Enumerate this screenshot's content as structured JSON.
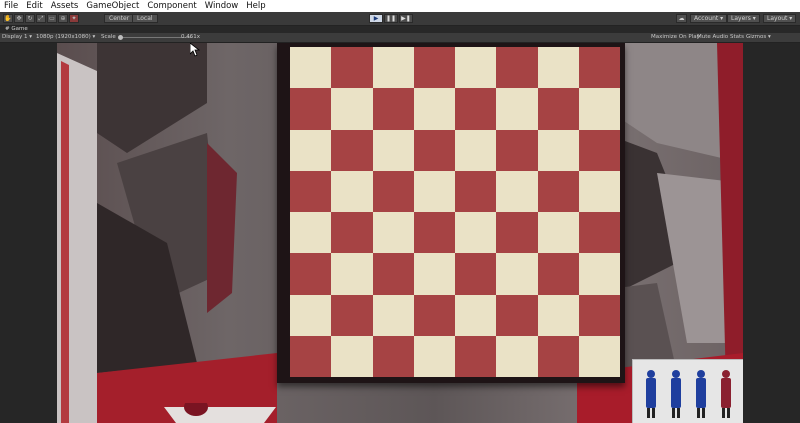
{
  "menubar": {
    "items": [
      "File",
      "Edit",
      "Assets",
      "GameObject",
      "Component",
      "Window",
      "Help"
    ]
  },
  "toolbar": {
    "tools": [
      "hand-icon",
      "move-icon",
      "rotate-icon",
      "scale-icon",
      "rect-icon",
      "transform-icon",
      "custom-tool-icon"
    ],
    "pivot_label": "Center",
    "space_label": "Local",
    "play": "▶",
    "pause": "❚❚",
    "step": "▶❚",
    "account_label": "Account ▾",
    "layers_label": "Layers ▾",
    "layout_label": "Layout ▾",
    "cloud_icon": "cloud-icon"
  },
  "game_tab": {
    "label": "# Game"
  },
  "gamebar": {
    "display": "Display 1 ▾",
    "resolution": "1080p (1920x1080) ▾",
    "scale_label": "Scale",
    "scale_value": "0.461x",
    "maximize": "Maximize On Play",
    "mute": "Mute Audio",
    "stats": "Stats",
    "gizmos": "Gizmos ▾"
  },
  "board": {
    "rows": 8,
    "cols": 8,
    "light_color": "#eae2c6",
    "dark_color": "#a64344",
    "top_left": "light"
  },
  "tray": {
    "pieces": [
      {
        "color": "#1f3f9e"
      },
      {
        "color": "#1f3f9e"
      },
      {
        "color": "#1f3f9e"
      },
      {
        "color": "#8a2030"
      },
      {
        "color": "#1f3f9e"
      },
      {
        "color": "#1f3f9e"
      }
    ]
  },
  "colors": {
    "menubar_bg": "#ffffff",
    "editor_bg": "#3a3a3a",
    "accent_red": "#a64344",
    "cream": "#eae2c6"
  }
}
